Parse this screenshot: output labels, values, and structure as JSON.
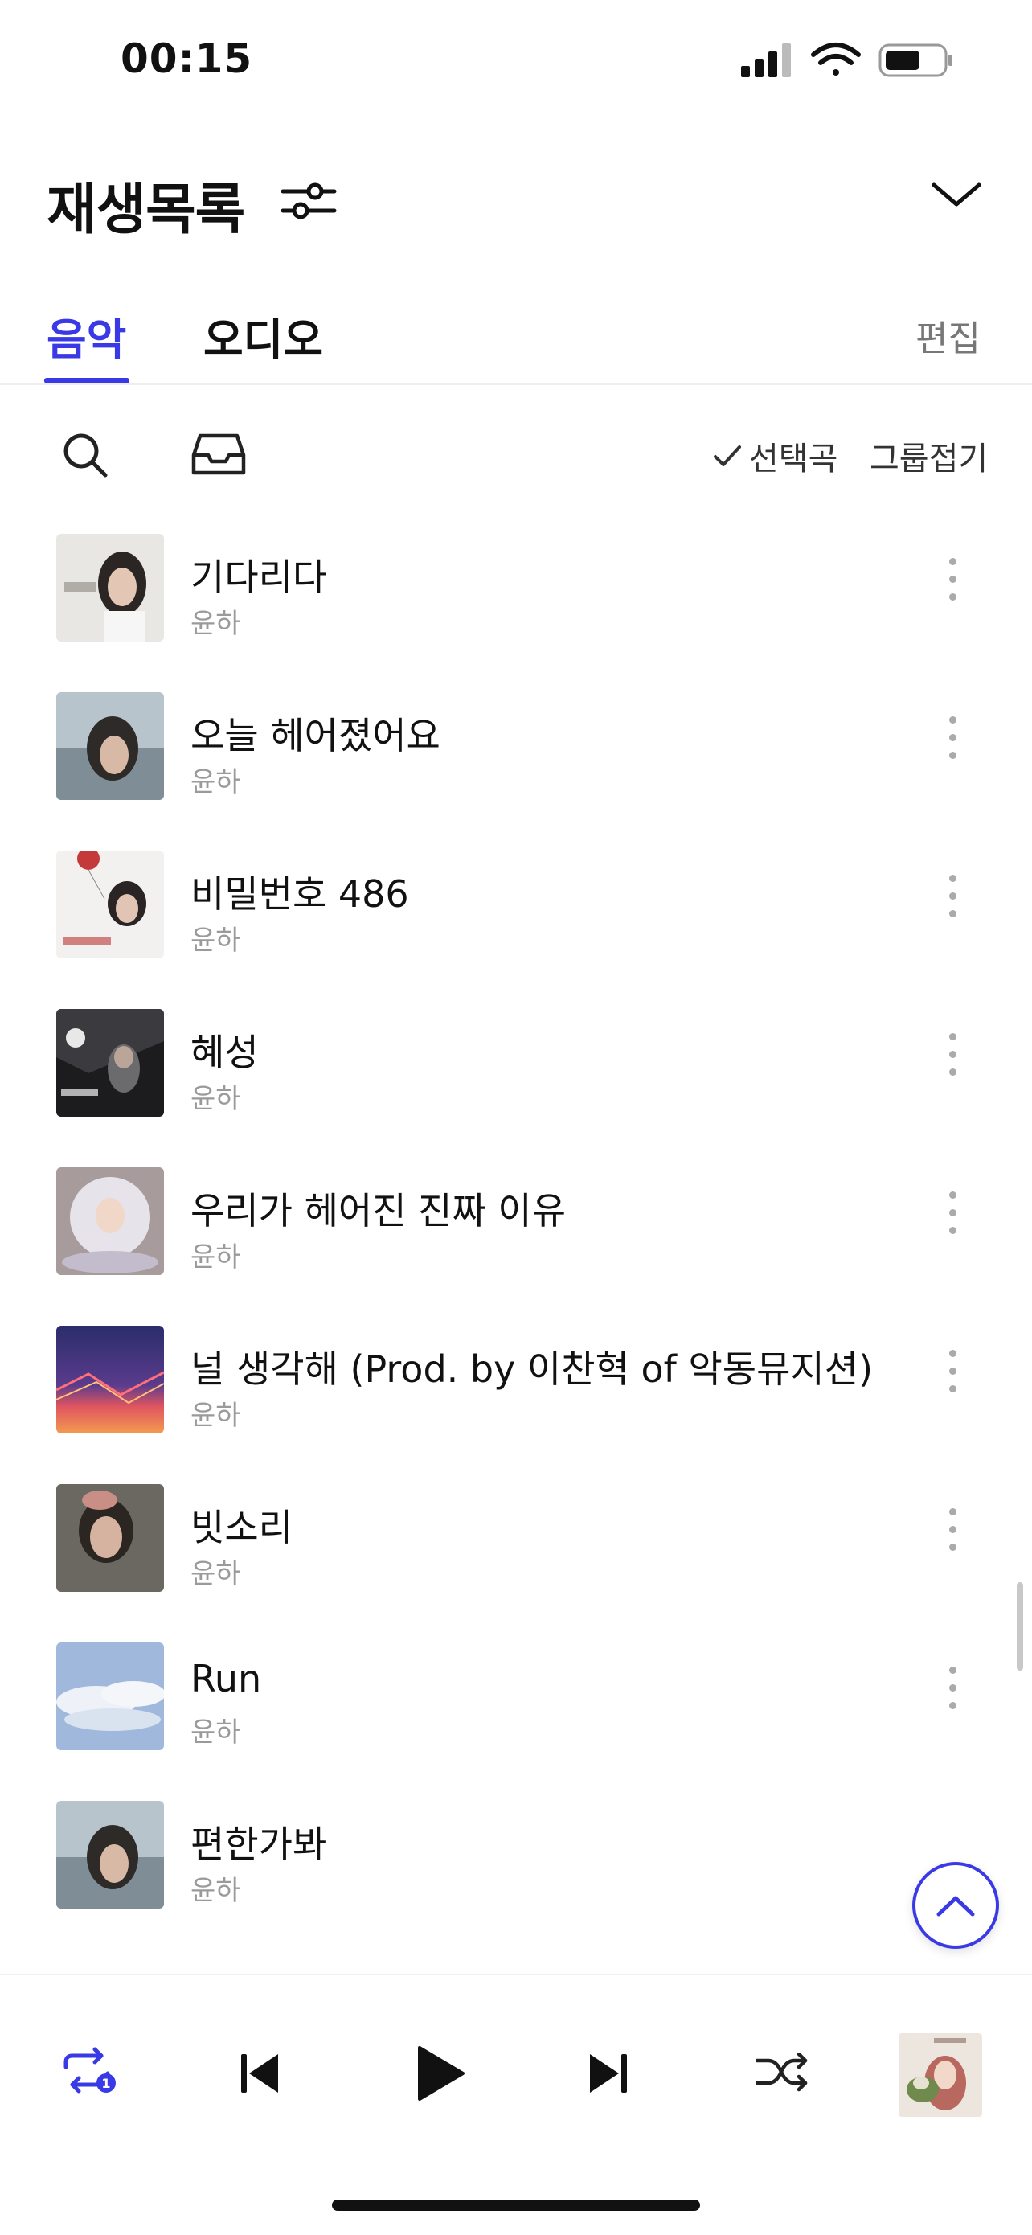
{
  "status_bar": {
    "time": "00:15"
  },
  "header": {
    "title": "재생목록"
  },
  "tabs": [
    {
      "label": "음악",
      "active": true
    },
    {
      "label": "오디오",
      "active": false
    }
  ],
  "edit_label": "편집",
  "toolbar": {
    "selected_label": "선택곡",
    "group_label": "그룹접기"
  },
  "songs": [
    {
      "title": "기다리다",
      "artist": "윤하"
    },
    {
      "title": "오늘 헤어졌어요",
      "artist": "윤하"
    },
    {
      "title": "비밀번호 486",
      "artist": "윤하"
    },
    {
      "title": "혜성",
      "artist": "윤하"
    },
    {
      "title": "우리가 헤어진 진짜 이유",
      "artist": "윤하"
    },
    {
      "title": "널 생각해 (Prod. by 이찬혁 of 악동뮤지션)",
      "artist": "윤하"
    },
    {
      "title": "빗소리",
      "artist": "윤하"
    },
    {
      "title": "Run",
      "artist": "윤하"
    },
    {
      "title": "편한가봐",
      "artist": "윤하"
    }
  ],
  "colors": {
    "accent": "#3a39e6",
    "secondary_text": "#9a9a9a"
  },
  "icons": {
    "filter": "sliders-icon",
    "collapse": "chevron-down-icon",
    "search": "search-icon",
    "inbox": "inbox-icon",
    "repeat": "repeat-one-icon",
    "prev": "skip-previous-icon",
    "play": "play-icon",
    "next": "skip-next-icon",
    "shuffle": "shuffle-icon"
  },
  "player": {
    "repeat_badge": "1"
  }
}
